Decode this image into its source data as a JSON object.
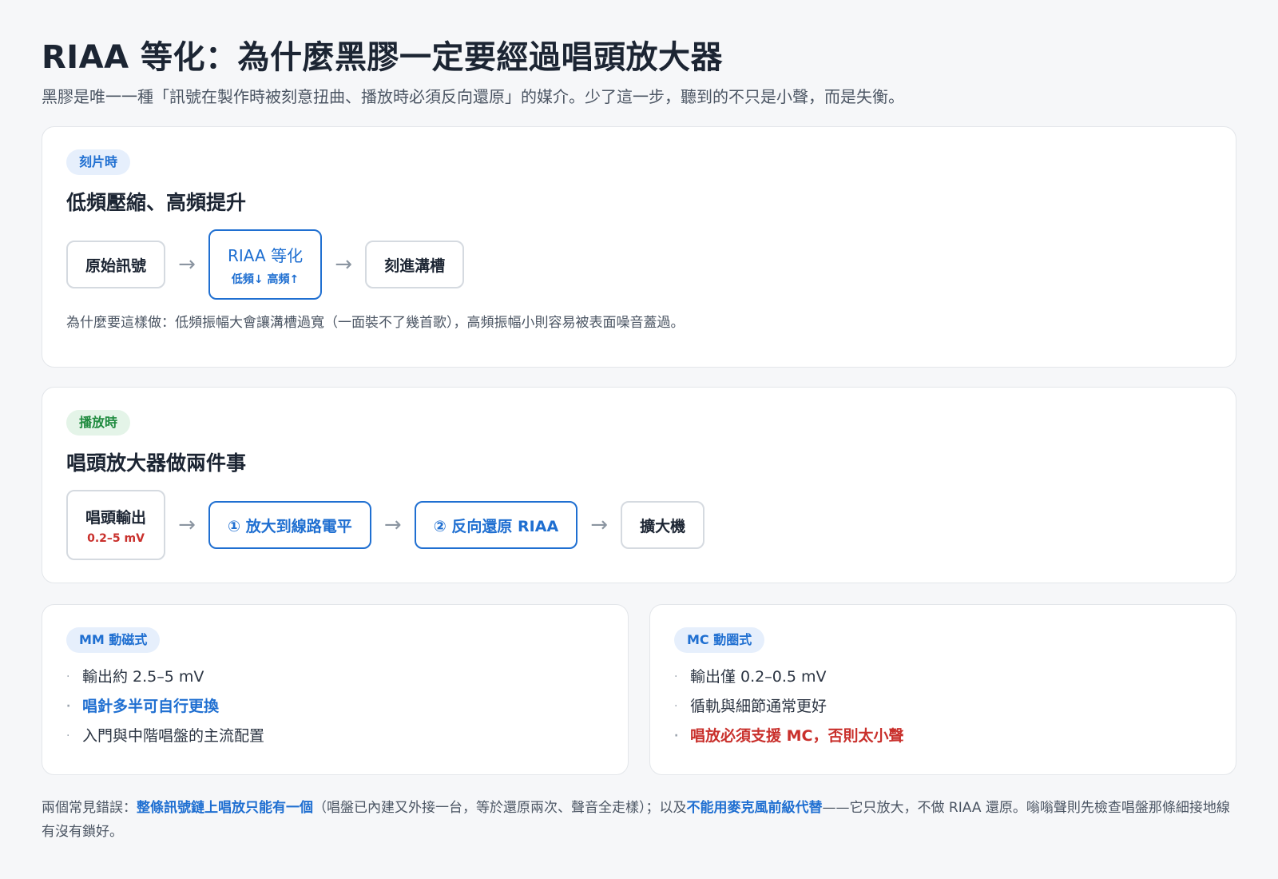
{
  "header": {
    "title": "RIAA 等化：為什麼黑膠一定要經過唱頭放大器",
    "subtitle": "黑膠是唯一一種「訊號在製作時被刻意扭曲、播放時必須反向還原」的媒介。少了這一步，聽到的不只是小聲，而是失衡。"
  },
  "cutting": {
    "pill": "刻片時",
    "heading": "低頻壓縮、高頻提升",
    "box1": "原始訊號",
    "box2_main": "RIAA 等化",
    "box2_sub": "低頻↓ 高頻↑",
    "box3": "刻進溝槽",
    "arrow": "→",
    "note": "為什麼要這樣做：低頻振幅大會讓溝槽過寬（一面裝不了幾首歌），高頻振幅小則容易被表面噪音蓋過。"
  },
  "playback": {
    "pill": "播放時",
    "heading": "唱頭放大器做兩件事",
    "box1_main": "唱頭輸出",
    "box1_sub": "0.2–5 mV",
    "box2": "① 放大到線路電平",
    "box3": "② 反向還原 RIAA",
    "box4": "擴大機",
    "arrow": "→"
  },
  "mm": {
    "pill": "MM 動磁式",
    "items": [
      "輸出約 2.5–5 mV",
      "唱針多半可自行更換",
      "入門與中階唱盤的主流配置"
    ]
  },
  "mc": {
    "pill": "MC 動圈式",
    "items": [
      "輸出僅 0.2–0.5 mV",
      "循軌與細節通常更好",
      "唱放必須支援 MC，否則太小聲"
    ]
  },
  "bullet": "·",
  "footer": {
    "t1": "兩個常見錯誤：",
    "b1": "整條訊號鏈上唱放只能有一個",
    "t2": "（唱盤已內建又外接一台，等於還原兩次、聲音全走樣）；以及",
    "b2": "不能用麥克風前級代替",
    "t3": "——它只放大，不做 RIAA 還原。嗡嗡聲則先檢查唱盤那條細接地線有沒有鎖好。"
  },
  "colors": {
    "accent": "#1f6fd1",
    "green": "#1e8a3e",
    "red": "#c9302c"
  }
}
